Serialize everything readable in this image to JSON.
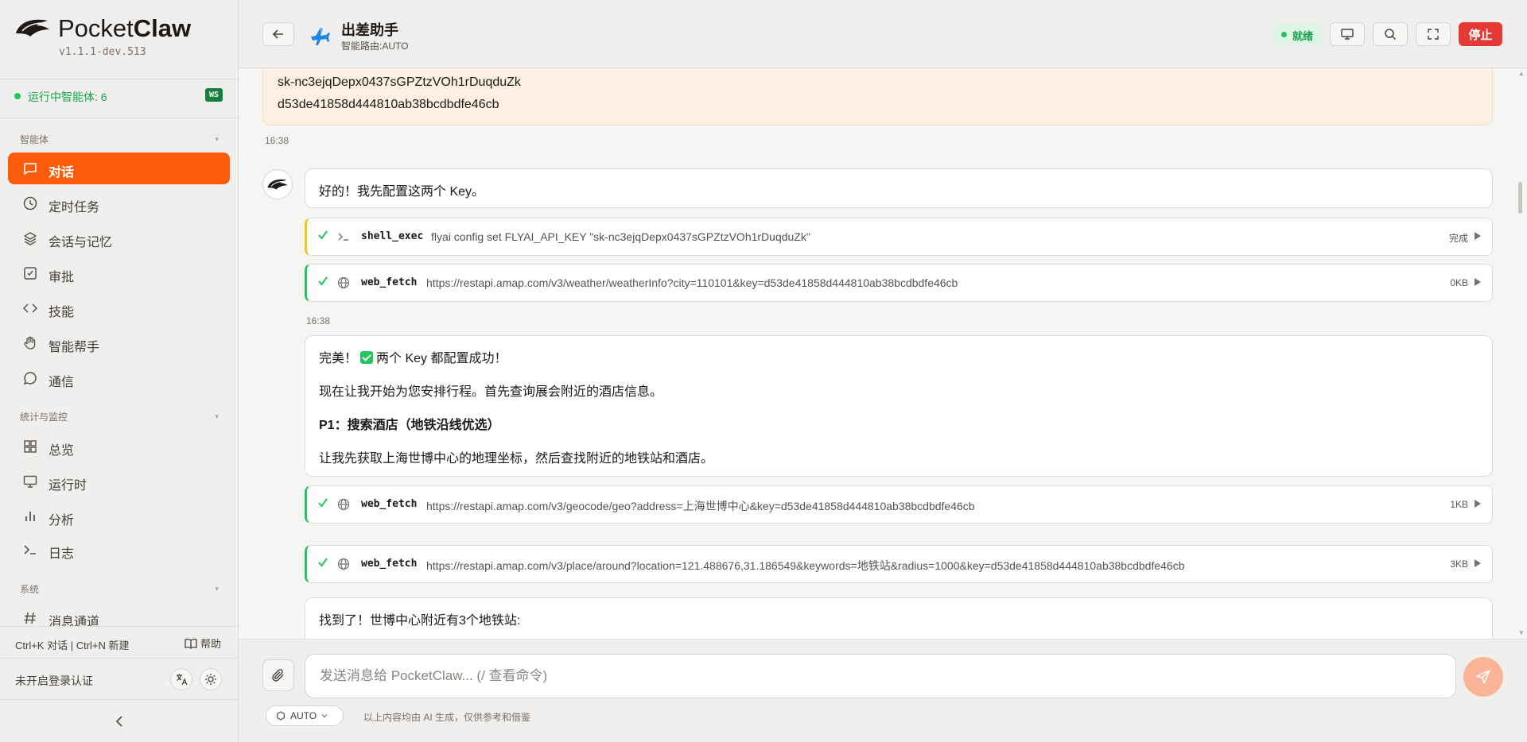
{
  "brand": {
    "name_regular": "Pocket",
    "name_bold": "Claw",
    "version": "v1.1.1-dev.513"
  },
  "status_bar": {
    "running_label": "运行中智能体: 6",
    "ws_badge": "WS"
  },
  "sidebar": {
    "sections": [
      {
        "title": "智能体",
        "items": [
          {
            "label": "对话",
            "icon": "chat-icon",
            "active": true
          },
          {
            "label": "定时任务",
            "icon": "clock-icon"
          },
          {
            "label": "会话与记忆",
            "icon": "layers-icon"
          },
          {
            "label": "审批",
            "icon": "checkbox-icon"
          },
          {
            "label": "技能",
            "icon": "code-icon"
          },
          {
            "label": "智能帮手",
            "icon": "hand-icon"
          },
          {
            "label": "通信",
            "icon": "message-icon"
          }
        ]
      },
      {
        "title": "统计与监控",
        "items": [
          {
            "label": "总览",
            "icon": "grid-icon"
          },
          {
            "label": "运行时",
            "icon": "monitor-icon"
          },
          {
            "label": "分析",
            "icon": "bar-chart-icon"
          },
          {
            "label": "日志",
            "icon": "terminal-icon"
          }
        ]
      },
      {
        "title": "系统",
        "items": [
          {
            "label": "消息通道",
            "icon": "hash-icon"
          }
        ]
      }
    ],
    "shortcuts": "Ctrl+K 对话 | Ctrl+N 新建",
    "help_label": "帮助",
    "auth_status": "未开启登录认证"
  },
  "header": {
    "title": "出差助手",
    "route": "智能路由:AUTO",
    "status": "就绪",
    "stop_label": "停止",
    "status_color": "#22c55e",
    "accent": "#fb5c0c"
  },
  "chat": {
    "user_message": {
      "lines": [
        "sk-nc3ejqDepx0437sGPZtzVOh1rDuqduZk",
        "d53de41858d444810ab38bcdbdfe46cb"
      ],
      "time": "16:38"
    },
    "assistant": {
      "greeting": "好的！我先配置这两个 Key。",
      "tools_1": [
        {
          "name": "shell_exec",
          "arg": "flyai config set FLYAI_API_KEY \"sk-nc3ejqDepx0437sGPZtzVOh1rDuqduZk\"",
          "meta": "完成",
          "icon": "terminal-icon"
        },
        {
          "name": "web_fetch",
          "arg": "https://restapi.amap.com/v3/weather/weatherInfo?city=110101&key=d53de41858d444810ab38bcdbdfe46cb",
          "meta": "0KB",
          "icon": "globe-icon"
        }
      ],
      "time2": "16:38",
      "message2": {
        "line1_pre": "完美！",
        "line1_post": "两个 Key 都配置成功！",
        "line2": "现在让我开始为您安排行程。首先查询展会附近的酒店信息。",
        "line3": "P1：搜索酒店（地铁沿线优选）",
        "line4": "让我先获取上海世博中心的地理坐标，然后查找附近的地铁站和酒店。"
      },
      "tools_2": [
        {
          "name": "web_fetch",
          "arg": "https://restapi.amap.com/v3/geocode/geo?address=上海世博中心&key=d53de41858d444810ab38bcdbdfe46cb",
          "meta": "1KB",
          "icon": "globe-icon"
        },
        {
          "name": "web_fetch",
          "arg": "https://restapi.amap.com/v3/place/around?location=121.488676,31.186549&keywords=地铁站&radius=1000&key=d53de41858d444810ab38bcdbdfe46cb",
          "meta": "3KB",
          "icon": "globe-icon"
        }
      ],
      "message3": "找到了！世博中心附近有3个地铁站:"
    }
  },
  "input": {
    "placeholder": "发送消息给 PocketClaw... (/ 查看命令)",
    "model_select": "AUTO",
    "disclaimer": "以上内容均由 AI 生成，仅供参考和借鉴"
  }
}
